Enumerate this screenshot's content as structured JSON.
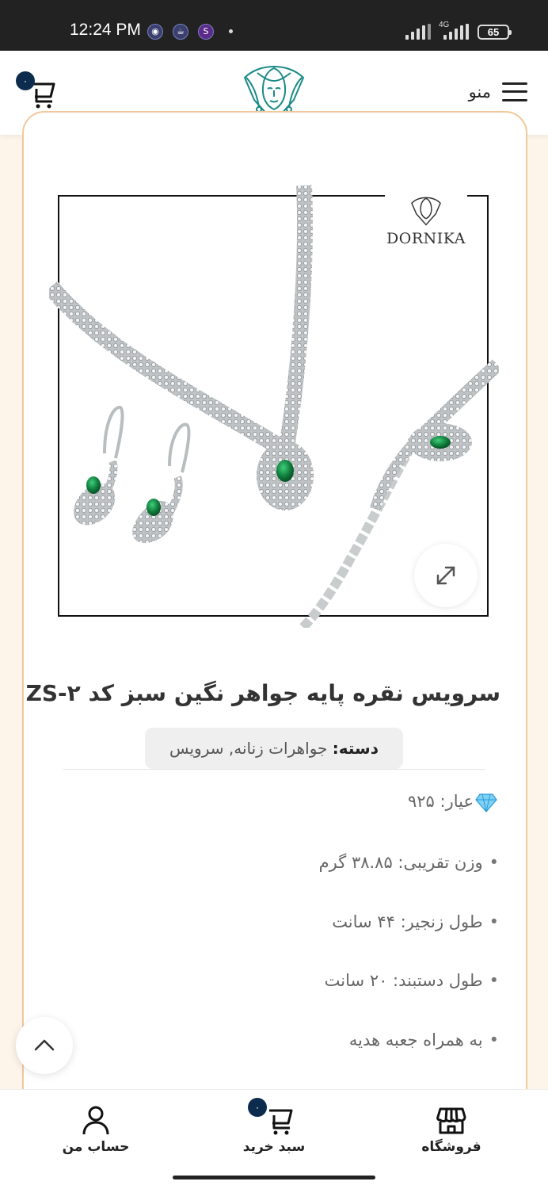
{
  "status_bar": {
    "time": "12:24 PM",
    "network": "4G",
    "battery": "65",
    "app_icons": [
      "app-icon-1",
      "app-icon-2",
      "app-icon-3"
    ]
  },
  "header": {
    "menu_label": "منو",
    "cart_count": "۰",
    "logo_icon": "woman-face-logo-icon"
  },
  "product": {
    "brand": "DORNIKA",
    "title": "سرویس نقره پایه جواهر نگین سبز کد ZS-۲",
    "category_label": "دسته:",
    "category_value": "جواهرات زنانه, سرویس",
    "specs": [
      {
        "text": "عیار: ۹۲۵",
        "bullet": ""
      },
      {
        "text": "وزن تقریبی: ۳۸.۸۵ گرم",
        "bullet": "•"
      },
      {
        "text": "طول زنجیر: ۴۴ سانت",
        "bullet": "•"
      },
      {
        "text": "طول دستبند: ۲۰ سانت",
        "bullet": "•"
      },
      {
        "text": "به همراه جعبه هدیه",
        "bullet": "•"
      }
    ]
  },
  "bottom_nav": {
    "shop_label": "فروشگاه",
    "cart_label": "سبد خرید",
    "cart_count": "۰",
    "account_label": "حساب من"
  },
  "colors": {
    "accent": "#0d2b4d",
    "logo": "#1a8a86",
    "card_border": "#f1c89a",
    "emerald": "#0f7a3a"
  }
}
